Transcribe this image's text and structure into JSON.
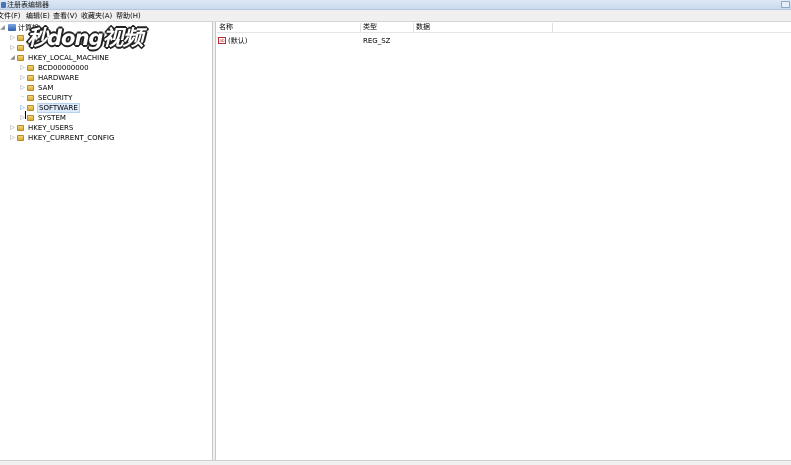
{
  "window": {
    "title": "注册表编辑器"
  },
  "menubar": {
    "items": [
      "文件(F)",
      "编辑(E)",
      "查看(V)",
      "收藏夹(A)",
      "帮助(H)"
    ]
  },
  "tree": {
    "root": "计算机",
    "hklm": "HKEY_LOCAL_MACHINE",
    "hklm_children": [
      "BCD00000000",
      "HARDWARE",
      "SAM",
      "SECURITY",
      "SOFTWARE",
      "SYSTEM"
    ],
    "others": [
      "HKEY_USERS",
      "HKEY_CURRENT_CONFIG"
    ],
    "selected": "SOFTWARE"
  },
  "list": {
    "columns": [
      "名称",
      "类型",
      "数据"
    ],
    "rows": [
      {
        "icon": "string-value-icon",
        "icon_text": "ab",
        "name": "(默认)",
        "type": "REG_SZ",
        "data": ""
      }
    ]
  },
  "watermark": {
    "text": "秒dong视频"
  }
}
